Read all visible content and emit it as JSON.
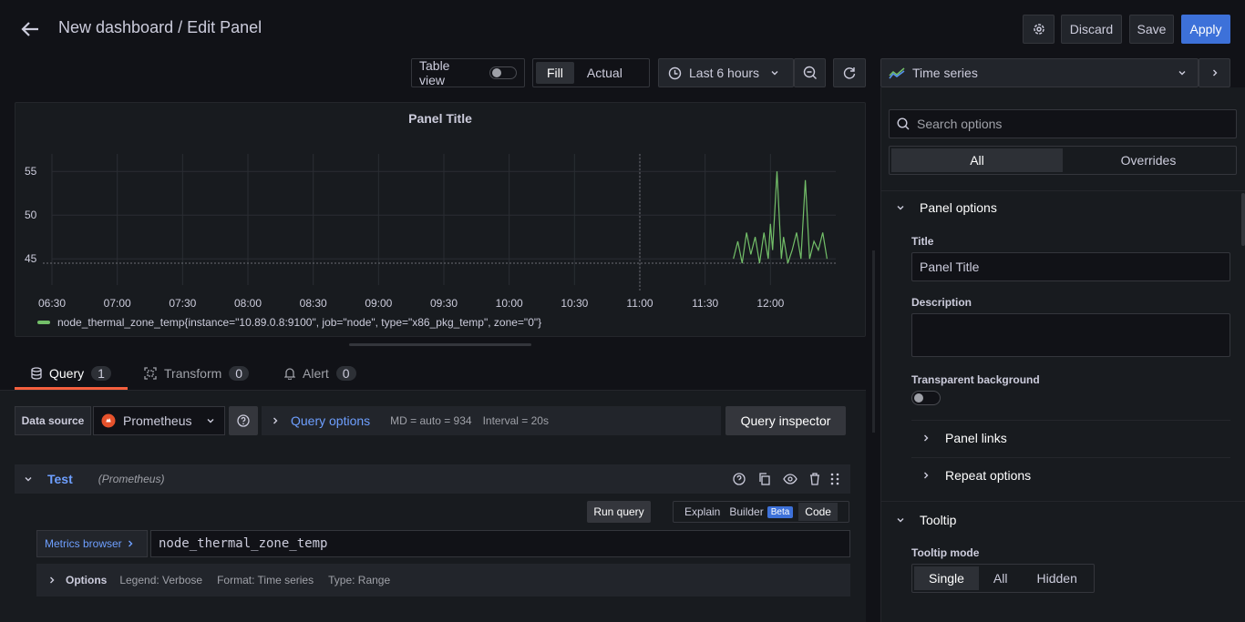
{
  "header": {
    "title": "New dashboard / Edit Panel",
    "discard_label": "Discard",
    "save_label": "Save",
    "apply_label": "Apply"
  },
  "toolbar": {
    "table_view_label": "Table view",
    "fill_label": "Fill",
    "actual_label": "Actual",
    "time_range_label": "Last 6 hours",
    "visualization_label": "Time series"
  },
  "panel": {
    "title": "Panel Title",
    "legend": "node_thermal_zone_temp{instance=\"10.89.0.8:9100\", job=\"node\", type=\"x86_pkg_temp\", zone=\"0\"}"
  },
  "chart_data": {
    "type": "line",
    "x_ticks": [
      "06:30",
      "07:00",
      "07:30",
      "08:00",
      "08:30",
      "09:00",
      "09:30",
      "10:00",
      "10:30",
      "11:00",
      "11:30",
      "12:00"
    ],
    "y_ticks": [
      55,
      50,
      45
    ],
    "ylim": [
      42,
      57
    ],
    "series": [
      {
        "name": "node_thermal_zone_temp{instance=\"10.89.0.8:9100\", job=\"node\", type=\"x86_pkg_temp\", zone=\"0\"}",
        "color": "#73bf69",
        "x": [
          "11:43",
          "11:45",
          "11:47",
          "11:49",
          "11:51",
          "11:53",
          "11:55",
          "11:57",
          "11:59",
          "12:00",
          "12:01",
          "12:03",
          "12:05",
          "12:06",
          "12:08",
          "12:10",
          "12:12",
          "12:14",
          "12:16",
          "12:18",
          "12:20",
          "12:22",
          "12:24",
          "12:26"
        ],
        "values": [
          45,
          47,
          44.5,
          48,
          45.5,
          47.5,
          44.5,
          48,
          45,
          49,
          46,
          55,
          45,
          47.5,
          44.5,
          46,
          48,
          45,
          54,
          45,
          47,
          46,
          48,
          45
        ]
      }
    ]
  },
  "tabs": [
    {
      "label": "Query",
      "count": "1"
    },
    {
      "label": "Transform",
      "count": "0"
    },
    {
      "label": "Alert",
      "count": "0"
    }
  ],
  "query_bar": {
    "data_source_label": "Data source",
    "data_source_value": "Prometheus",
    "query_options_label": "Query options",
    "md_text": "MD = auto = 934",
    "interval_text": "Interval = 20s",
    "inspector_label": "Query inspector"
  },
  "query_row": {
    "name": "Test",
    "source": "(Prometheus)",
    "run_query_label": "Run query",
    "explain_label": "Explain",
    "builder_label": "Builder",
    "beta_label": "Beta",
    "code_label": "Code",
    "metrics_browser_label": "Metrics browser",
    "query_value": "node_thermal_zone_temp",
    "options_label": "Options",
    "legend_text": "Legend: Verbose",
    "format_text": "Format: Time series",
    "type_text": "Type: Range"
  },
  "options_pane": {
    "search_placeholder": "Search options",
    "all_tab": "All",
    "overrides_tab": "Overrides",
    "panel_options_label": "Panel options",
    "title_label": "Title",
    "title_value": "Panel Title",
    "description_label": "Description",
    "transparent_label": "Transparent background",
    "panel_links_label": "Panel links",
    "repeat_options_label": "Repeat options",
    "tooltip_label": "Tooltip",
    "tooltip_mode_label": "Tooltip mode",
    "tooltip_single": "Single",
    "tooltip_all": "All",
    "tooltip_hidden": "Hidden"
  }
}
